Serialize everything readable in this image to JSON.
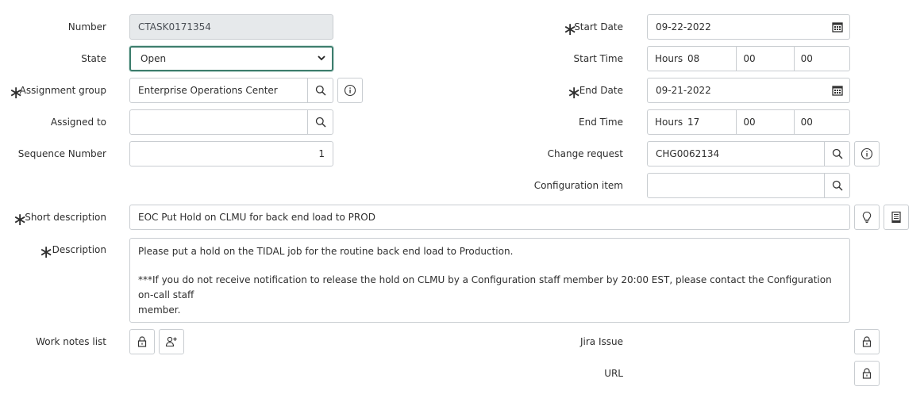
{
  "left": {
    "number": {
      "label": "Number",
      "value": "CTASK0171354"
    },
    "state": {
      "label": "State",
      "value": "Open"
    },
    "assignment_group": {
      "label": "Assignment group",
      "value": "Enterprise Operations Center"
    },
    "assigned_to": {
      "label": "Assigned to",
      "value": ""
    },
    "sequence_number": {
      "label": "Sequence Number",
      "value": "1"
    }
  },
  "right": {
    "start_date": {
      "label": "Start Date",
      "value": "09-22-2022"
    },
    "start_time": {
      "label": "Start Time",
      "hours_label": "Hours",
      "hours": "08",
      "minutes": "00",
      "seconds": "00"
    },
    "end_date": {
      "label": "End Date",
      "value": "09-21-2022"
    },
    "end_time": {
      "label": "End Time",
      "hours_label": "Hours",
      "hours": "17",
      "minutes": "00",
      "seconds": "00"
    },
    "change_request": {
      "label": "Change request",
      "value": "CHG0062134"
    },
    "configuration_item": {
      "label": "Configuration item",
      "value": ""
    }
  },
  "short_description": {
    "label": "Short description",
    "value": "EOC Put Hold on CLMU for back end load to PROD"
  },
  "description": {
    "label": "Description",
    "line1": "Please put a hold on the TIDAL job for the routine back end load to Production.",
    "line2": "***If you do not receive notification to release the hold on CLMU by a Configuration staff member by 20:00 EST, please contact the Configuration on-call staff",
    "line3": "member."
  },
  "work_notes_list": {
    "label": "Work notes list"
  },
  "jira_issue": {
    "label": "Jira Issue"
  },
  "url": {
    "label": "URL"
  },
  "icons": {
    "search": "search-icon",
    "info": "info-icon",
    "calendar": "calendar-icon",
    "lightbulb": "lightbulb-icon",
    "book": "book-icon",
    "lock": "lock-icon",
    "add_user": "add-user-icon"
  }
}
